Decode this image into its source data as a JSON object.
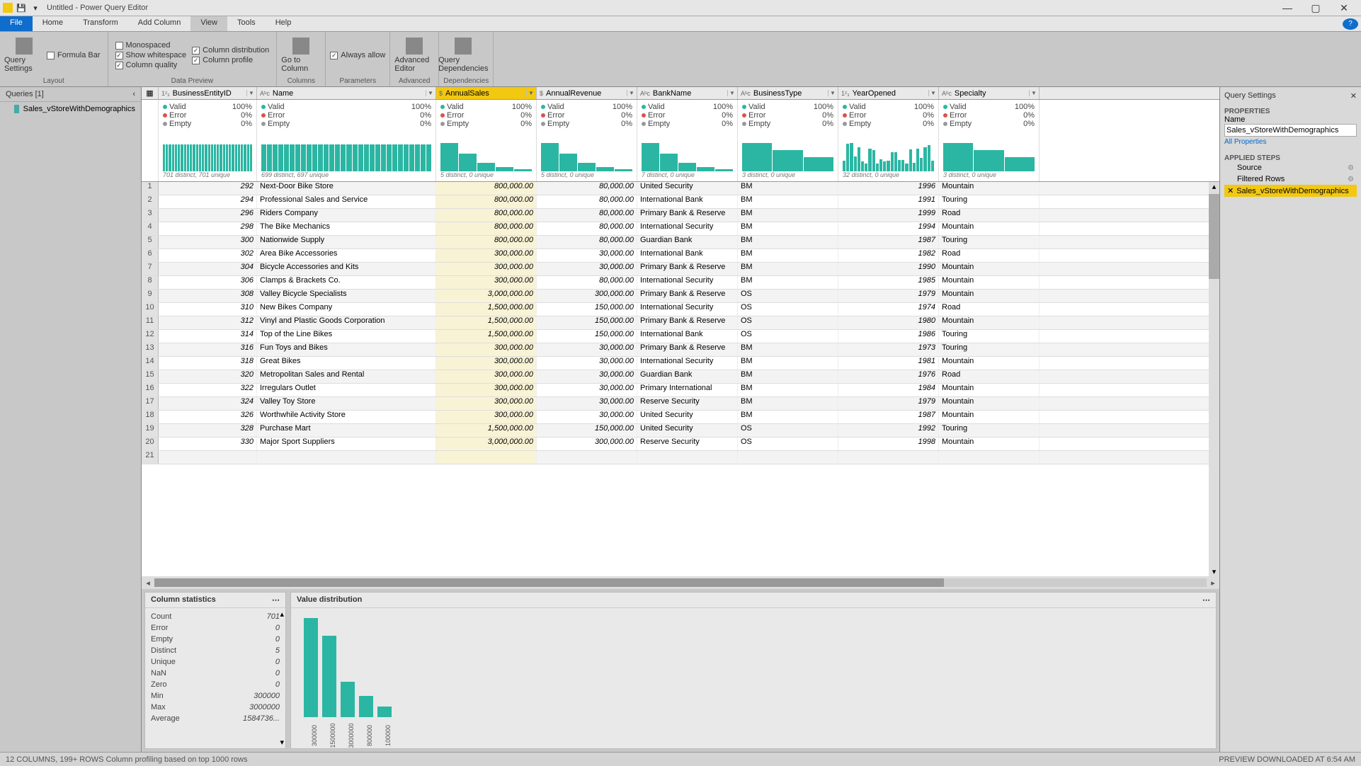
{
  "title": "Untitled - Power Query Editor",
  "menus": {
    "file": "File",
    "tabs": [
      "Home",
      "Transform",
      "Add Column",
      "View",
      "Tools",
      "Help"
    ],
    "active": "View"
  },
  "ribbon": {
    "layout": {
      "label": "Layout",
      "big": "Query Settings",
      "formulaBar": "Formula Bar"
    },
    "dataPreview": {
      "label": "Data Preview",
      "c1": [
        "Monospaced",
        "Show whitespace",
        "Column quality"
      ],
      "c2": [
        "Column distribution",
        "Column profile"
      ],
      "checked": [
        "Show whitespace",
        "Column quality",
        "Column distribution",
        "Column profile"
      ]
    },
    "columns": {
      "label": "Columns",
      "big": "Go to Column"
    },
    "parameters": {
      "label": "Parameters",
      "chk": "Always allow"
    },
    "advanced": {
      "label": "Advanced",
      "big": "Advanced Editor"
    },
    "dependencies": {
      "label": "Dependencies",
      "big": "Query Dependencies"
    }
  },
  "queriesPane": {
    "header": "Queries [1]",
    "items": [
      "Sales_vStoreWithDemographics"
    ]
  },
  "columns": [
    {
      "name": "BusinessEntityID",
      "type": "1²₃",
      "distinct": "701 distinct, 701 unique",
      "bars": "flat"
    },
    {
      "name": "Name",
      "type": "Aᵇc",
      "distinct": "699 distinct, 697 unique",
      "bars": "flat"
    },
    {
      "name": "AnnualSales",
      "type": "$",
      "distinct": "5 distinct, 0 unique",
      "bars": "skew",
      "selected": true
    },
    {
      "name": "AnnualRevenue",
      "type": "$",
      "distinct": "5 distinct, 0 unique",
      "bars": "skew"
    },
    {
      "name": "BankName",
      "type": "Aᵇc",
      "distinct": "7 distinct, 0 unique",
      "bars": "skew"
    },
    {
      "name": "BusinessType",
      "type": "Aᵇc",
      "distinct": "3 distinct, 0 unique",
      "bars": "three"
    },
    {
      "name": "YearOpened",
      "type": "1²₃",
      "distinct": "32 distinct, 0 unique",
      "bars": "many"
    },
    {
      "name": "Specialty",
      "type": "Aᵇc",
      "distinct": "3 distinct, 0 unique",
      "bars": "three"
    }
  ],
  "quality": {
    "valid": "Valid",
    "validPct": "100%",
    "error": "Error",
    "errorPct": "0%",
    "empty": "Empty",
    "emptyPct": "0%"
  },
  "rows": [
    {
      "n": 1,
      "id": 292,
      "name": "Next-Door Bike Store",
      "sales": "800,000.00",
      "rev": "80,000.00",
      "bank": "United Security",
      "btype": "BM",
      "year": 1996,
      "spec": "Mountain"
    },
    {
      "n": 2,
      "id": 294,
      "name": "Professional Sales and Service",
      "sales": "800,000.00",
      "rev": "80,000.00",
      "bank": "International Bank",
      "btype": "BM",
      "year": 1991,
      "spec": "Touring"
    },
    {
      "n": 3,
      "id": 296,
      "name": "Riders Company",
      "sales": "800,000.00",
      "rev": "80,000.00",
      "bank": "Primary Bank & Reserve",
      "btype": "BM",
      "year": 1999,
      "spec": "Road"
    },
    {
      "n": 4,
      "id": 298,
      "name": "The Bike Mechanics",
      "sales": "800,000.00",
      "rev": "80,000.00",
      "bank": "International Security",
      "btype": "BM",
      "year": 1994,
      "spec": "Mountain"
    },
    {
      "n": 5,
      "id": 300,
      "name": "Nationwide Supply",
      "sales": "800,000.00",
      "rev": "80,000.00",
      "bank": "Guardian Bank",
      "btype": "BM",
      "year": 1987,
      "spec": "Touring"
    },
    {
      "n": 6,
      "id": 302,
      "name": "Area Bike Accessories",
      "sales": "300,000.00",
      "rev": "30,000.00",
      "bank": "International Bank",
      "btype": "BM",
      "year": 1982,
      "spec": "Road"
    },
    {
      "n": 7,
      "id": 304,
      "name": "Bicycle Accessories and Kits",
      "sales": "300,000.00",
      "rev": "30,000.00",
      "bank": "Primary Bank & Reserve",
      "btype": "BM",
      "year": 1990,
      "spec": "Mountain"
    },
    {
      "n": 8,
      "id": 306,
      "name": "Clamps & Brackets Co.",
      "sales": "300,000.00",
      "rev": "80,000.00",
      "bank": "International Security",
      "btype": "BM",
      "year": 1985,
      "spec": "Mountain"
    },
    {
      "n": 9,
      "id": 308,
      "name": "Valley Bicycle Specialists",
      "sales": "3,000,000.00",
      "rev": "300,000.00",
      "bank": "Primary Bank & Reserve",
      "btype": "OS",
      "year": 1979,
      "spec": "Mountain"
    },
    {
      "n": 10,
      "id": 310,
      "name": "New Bikes Company",
      "sales": "1,500,000.00",
      "rev": "150,000.00",
      "bank": "International Security",
      "btype": "OS",
      "year": 1974,
      "spec": "Road"
    },
    {
      "n": 11,
      "id": 312,
      "name": "Vinyl and Plastic Goods Corporation",
      "sales": "1,500,000.00",
      "rev": "150,000.00",
      "bank": "Primary Bank & Reserve",
      "btype": "OS",
      "year": 1980,
      "spec": "Mountain"
    },
    {
      "n": 12,
      "id": 314,
      "name": "Top of the Line Bikes",
      "sales": "1,500,000.00",
      "rev": "150,000.00",
      "bank": "International Bank",
      "btype": "OS",
      "year": 1986,
      "spec": "Touring"
    },
    {
      "n": 13,
      "id": 316,
      "name": "Fun Toys and Bikes",
      "sales": "300,000.00",
      "rev": "30,000.00",
      "bank": "Primary Bank & Reserve",
      "btype": "BM",
      "year": 1973,
      "spec": "Touring"
    },
    {
      "n": 14,
      "id": 318,
      "name": "Great Bikes ",
      "sales": "300,000.00",
      "rev": "30,000.00",
      "bank": "International Security",
      "btype": "BM",
      "year": 1981,
      "spec": "Mountain"
    },
    {
      "n": 15,
      "id": 320,
      "name": "Metropolitan Sales and Rental",
      "sales": "300,000.00",
      "rev": "30,000.00",
      "bank": "Guardian Bank",
      "btype": "BM",
      "year": 1976,
      "spec": "Road"
    },
    {
      "n": 16,
      "id": 322,
      "name": "Irregulars Outlet",
      "sales": "300,000.00",
      "rev": "30,000.00",
      "bank": "Primary International",
      "btype": "BM",
      "year": 1984,
      "spec": "Mountain"
    },
    {
      "n": 17,
      "id": 324,
      "name": "Valley Toy Store",
      "sales": "300,000.00",
      "rev": "30,000.00",
      "bank": "Reserve Security",
      "btype": "BM",
      "year": 1979,
      "spec": "Mountain"
    },
    {
      "n": 18,
      "id": 326,
      "name": "Worthwhile Activity Store",
      "sales": "300,000.00",
      "rev": "30,000.00",
      "bank": "United Security",
      "btype": "BM",
      "year": 1987,
      "spec": "Mountain"
    },
    {
      "n": 19,
      "id": 328,
      "name": "Purchase Mart",
      "sales": "1,500,000.00",
      "rev": "150,000.00",
      "bank": "United Security",
      "btype": "OS",
      "year": 1992,
      "spec": "Touring"
    },
    {
      "n": 20,
      "id": 330,
      "name": "Major Sport Suppliers",
      "sales": "3,000,000.00",
      "rev": "300,000.00",
      "bank": "Reserve Security",
      "btype": "OS",
      "year": 1998,
      "spec": "Mountain"
    },
    {
      "n": 21,
      "id": "",
      "name": "",
      "sales": "",
      "rev": "",
      "bank": "",
      "btype": "",
      "year": "",
      "spec": ""
    }
  ],
  "colStats": {
    "title": "Column statistics",
    "rows": [
      [
        "Count",
        "701"
      ],
      [
        "Error",
        "0"
      ],
      [
        "Empty",
        "0"
      ],
      [
        "Distinct",
        "5"
      ],
      [
        "Unique",
        "0"
      ],
      [
        "NaN",
        "0"
      ],
      [
        "Zero",
        "0"
      ],
      [
        "Min",
        "300000"
      ],
      [
        "Max",
        "3000000"
      ],
      [
        "Average",
        "1584736..."
      ]
    ]
  },
  "valueDist": {
    "title": "Value distribution"
  },
  "chart_data": {
    "type": "bar",
    "categories": [
      "300000",
      "1500000",
      "3000000",
      "800000",
      "100000"
    ],
    "values": [
      280,
      230,
      100,
      60,
      30
    ],
    "title": "Value distribution",
    "xlabel": "",
    "ylabel": "",
    "ylim": [
      0,
      300
    ]
  },
  "querySettings": {
    "header": "Query Settings",
    "properties": "PROPERTIES",
    "nameLabel": "Name",
    "name": "Sales_vStoreWithDemographics",
    "allProps": "All Properties",
    "applied": "APPLIED STEPS",
    "steps": [
      "Source",
      "Filtered Rows",
      "Sales_vStoreWithDemographics"
    ],
    "selectedStep": 2
  },
  "status": {
    "left": "12 COLUMNS, 199+ ROWS    Column profiling based on top 1000 rows",
    "right": "PREVIEW DOWNLOADED AT 6:54 AM"
  }
}
